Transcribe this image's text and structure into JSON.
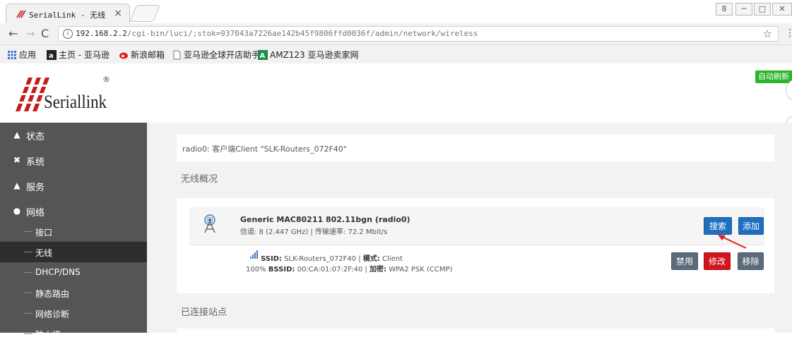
{
  "browser": {
    "tab_title": "SerialLink - 无线",
    "tab_close": "×",
    "url_host": "192.168.2.2",
    "url_path": "/cgi-bin/luci/;stok=937043a7226ae142b45f9806ffd0036f/admin/network/wireless",
    "info_glyph": "i",
    "star_glyph": "☆",
    "menu_glyph": "⋮",
    "win_controls": [
      "8",
      "─",
      "□",
      "✕"
    ],
    "bookmarks": [
      {
        "label": "应用",
        "icon": "apps-grid-icon"
      },
      {
        "label": "主页 - 亚马逊",
        "icon": "amazon-a-icon"
      },
      {
        "label": "新浪邮箱",
        "icon": "sina-eye-icon"
      },
      {
        "label": "亚马逊全球开店助手",
        "icon": "page-icon"
      },
      {
        "label": "AMZ123 亚马逊卖家网",
        "icon": "amz-icon"
      }
    ]
  },
  "header": {
    "logo_text": "Seriallink",
    "logo_reg": "®",
    "auto_refresh": "自动刷新 开"
  },
  "sidebar": {
    "items": [
      {
        "label": "状态",
        "icon": "home-icon"
      },
      {
        "label": "系统",
        "icon": "tools-icon"
      },
      {
        "label": "服务",
        "icon": "services-icon"
      },
      {
        "label": "网络",
        "icon": "globe-icon"
      }
    ],
    "subitems": [
      {
        "label": "接口",
        "active": false
      },
      {
        "label": "无线",
        "active": true
      },
      {
        "label": "DHCP/DNS",
        "active": false
      },
      {
        "label": "静态路由",
        "active": false
      },
      {
        "label": "网络诊断",
        "active": false
      },
      {
        "label": "防火墙",
        "active": false
      }
    ]
  },
  "main": {
    "assoc_text": "radio0: 客户端Client \"SLK-Routers_072F40\"",
    "overview_title": "无线概况",
    "device": {
      "name": "Generic MAC80211 802.11bgn (radio0)",
      "info": "信道: 8 (2.447 GHz) | 传输速率: 72.2 Mbit/s",
      "scan_button": "搜索",
      "add_button": "添加"
    },
    "network": {
      "ssid_label": "SSID:",
      "ssid": "SLK-Routers_072F40",
      "mode_label": "模式:",
      "mode": "Client",
      "signal": "100%",
      "bssid_label": "BSSID:",
      "bssid": "00:CA:01:07:2F:40",
      "enc_label": "加密:",
      "enc": "WPA2 PSK (CCMP)",
      "disable_button": "禁用",
      "edit_button": "修改",
      "remove_button": "移除"
    },
    "connected_title": "已连接站点"
  },
  "colors": {
    "sidebar_bg": "#555555",
    "sidebar_active": "#2e2e2e",
    "btn_blue": "#1e6fbd",
    "btn_gray": "#5b6b7b",
    "btn_red": "#d2141e",
    "refresh_green": "#2bb52b"
  }
}
